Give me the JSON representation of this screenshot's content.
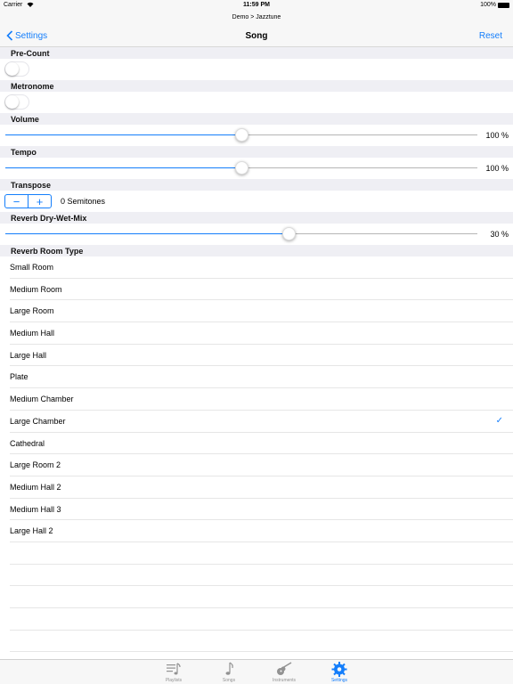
{
  "status_bar": {
    "carrier": "Carrier",
    "time": "11:59 PM",
    "battery": "100%",
    "battery_level": 1.0
  },
  "nav": {
    "breadcrumb": "Demo > Jazztune",
    "title": "Song",
    "back_label": "Settings",
    "reset_label": "Reset"
  },
  "sections": {
    "precount": {
      "title": "Pre-Count",
      "on": false
    },
    "metronome": {
      "title": "Metronome",
      "on": false
    },
    "volume": {
      "title": "Volume",
      "value_label": "100 %",
      "level": 0.5
    },
    "tempo": {
      "title": "Tempo",
      "value_label": "100 %",
      "level": 0.5
    },
    "transpose": {
      "title": "Transpose",
      "value_label": "0 Semitones",
      "minus": "−",
      "plus": "+"
    },
    "reverb_mix": {
      "title": "Reverb Dry-Wet-Mix",
      "value_label": "30 %",
      "level": 0.6
    },
    "reverb_room": {
      "title": "Reverb Room Type"
    }
  },
  "room_types": [
    {
      "label": "Small Room",
      "selected": false
    },
    {
      "label": "Medium Room",
      "selected": false
    },
    {
      "label": "Large Room",
      "selected": false
    },
    {
      "label": "Medium Hall",
      "selected": false
    },
    {
      "label": "Large Hall",
      "selected": false
    },
    {
      "label": "Plate",
      "selected": false
    },
    {
      "label": "Medium Chamber",
      "selected": false
    },
    {
      "label": "Large Chamber",
      "selected": true
    },
    {
      "label": "Cathedral",
      "selected": false
    },
    {
      "label": "Large Room 2",
      "selected": false
    },
    {
      "label": "Medium Hall 2",
      "selected": false
    },
    {
      "label": "Medium Hall 3",
      "selected": false
    },
    {
      "label": "Large Hall 2",
      "selected": false
    }
  ],
  "check_glyph": "✓",
  "tabs": [
    {
      "label": "Playlists",
      "icon": "playlist-icon",
      "active": false
    },
    {
      "label": "Songs",
      "icon": "music-note-icon",
      "active": false
    },
    {
      "label": "Instruments",
      "icon": "guitar-icon",
      "active": false
    },
    {
      "label": "Settings",
      "icon": "gear-icon",
      "active": true
    }
  ],
  "colors": {
    "accent": "#147efb",
    "background": "#efeff4",
    "inactive_tab": "#929292"
  }
}
